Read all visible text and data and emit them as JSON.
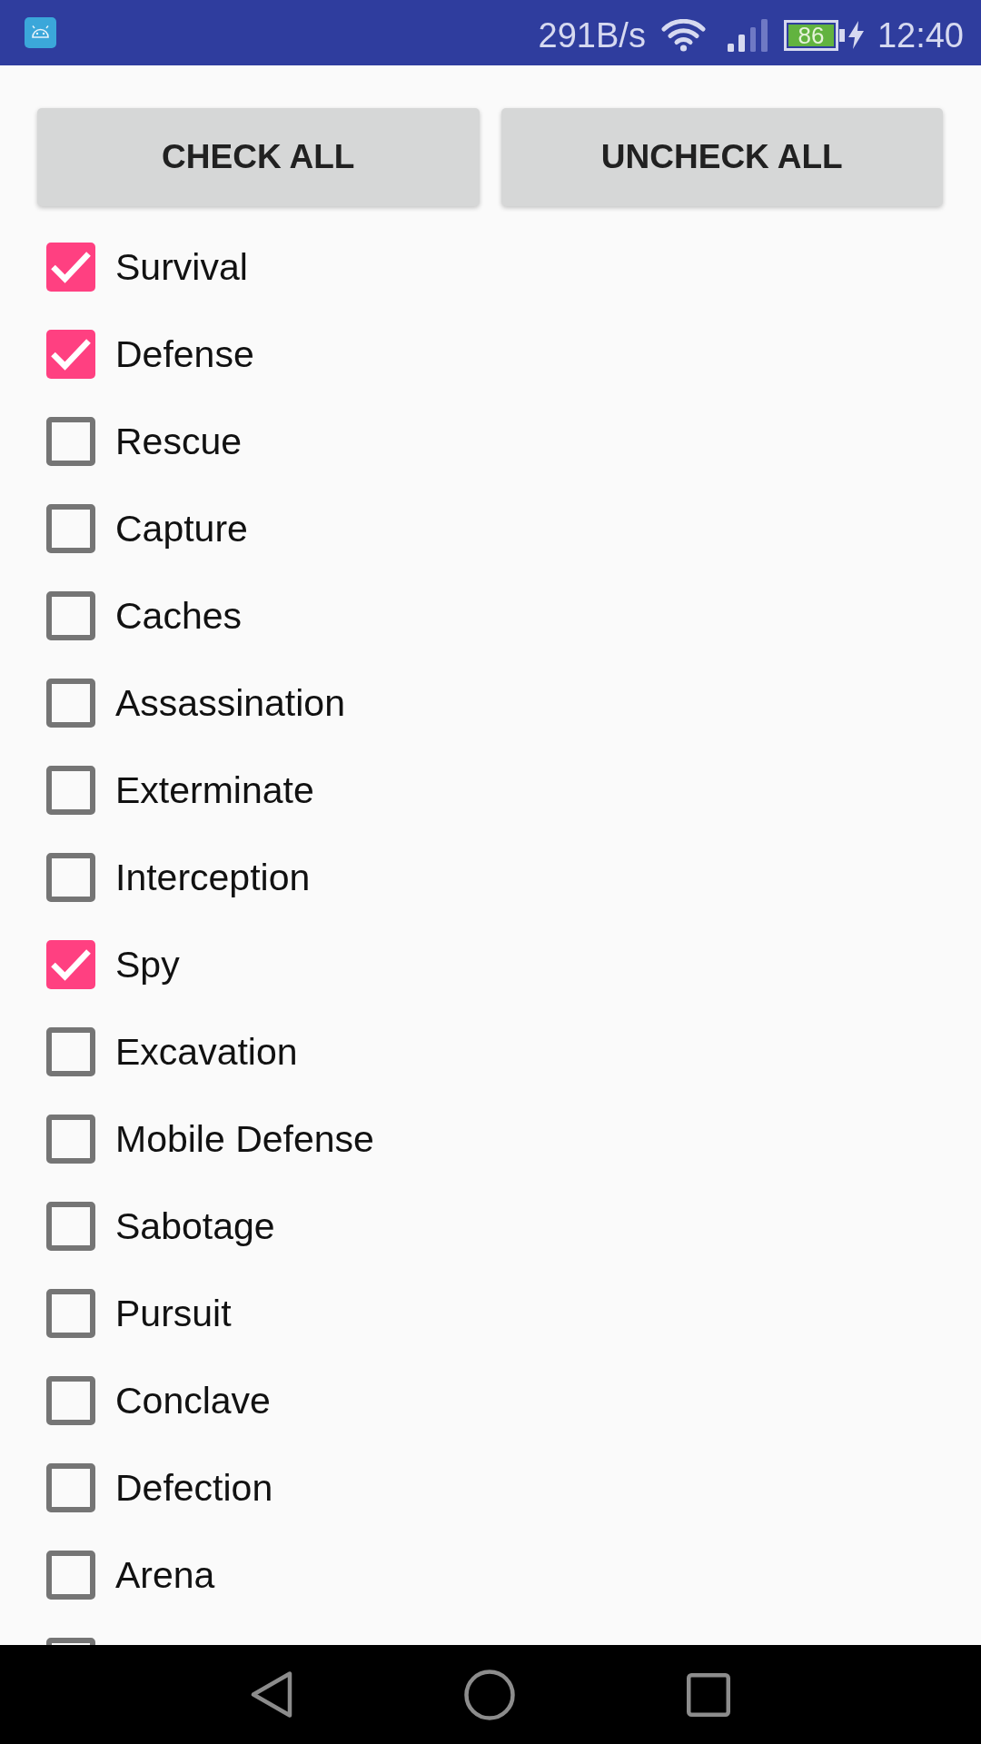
{
  "status_bar": {
    "network_speed": "291B/s",
    "battery_text": "86",
    "charging": true,
    "time": "12:40"
  },
  "buttons": [
    {
      "label": "CHECK ALL"
    },
    {
      "label": "UNCHECK ALL"
    }
  ],
  "missions": [
    {
      "label": "Survival",
      "checked": true
    },
    {
      "label": "Defense",
      "checked": true
    },
    {
      "label": "Rescue",
      "checked": false
    },
    {
      "label": "Capture",
      "checked": false
    },
    {
      "label": "Caches",
      "checked": false
    },
    {
      "label": "Assassination",
      "checked": false
    },
    {
      "label": "Exterminate",
      "checked": false
    },
    {
      "label": "Interception",
      "checked": false
    },
    {
      "label": "Spy",
      "checked": true
    },
    {
      "label": "Excavation",
      "checked": false
    },
    {
      "label": "Mobile Defense",
      "checked": false
    },
    {
      "label": "Sabotage",
      "checked": false
    },
    {
      "label": "Pursuit",
      "checked": false
    },
    {
      "label": "Conclave",
      "checked": false
    },
    {
      "label": "Defection",
      "checked": false
    },
    {
      "label": "Arena",
      "checked": false
    },
    {
      "checked": false
    }
  ]
}
